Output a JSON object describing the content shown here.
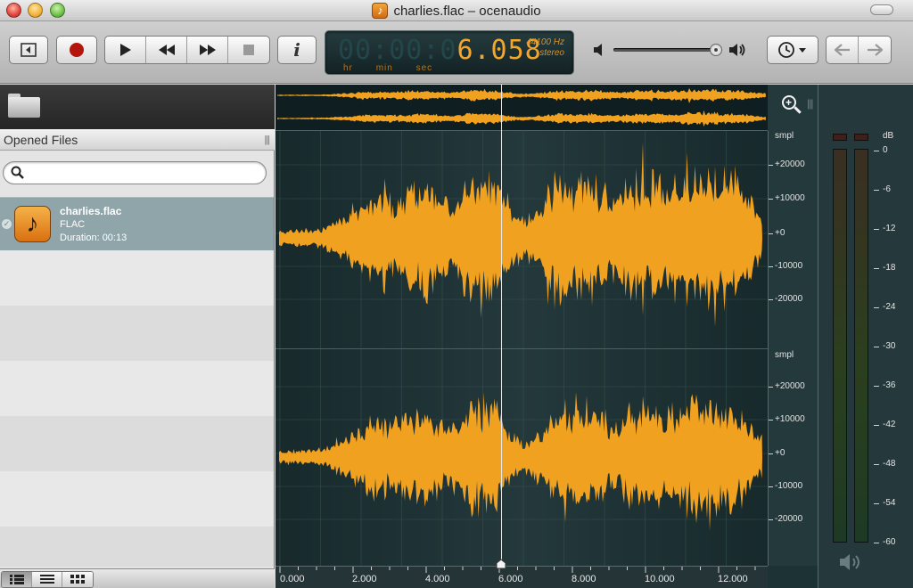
{
  "window": {
    "title": "charlies.flac – ocenaudio"
  },
  "toolbar": {
    "lcd": {
      "time_dim": "00:00:0",
      "time_lit": "6.058",
      "units": [
        "hr",
        "min",
        "sec"
      ],
      "rate": "44100 Hz",
      "channels": "stereo"
    },
    "volume": 0.95,
    "colors": {
      "accent": "#f4a62a",
      "lcd_bg": "#132224"
    }
  },
  "sidebar": {
    "header": "Opened Files",
    "search": {
      "value": "",
      "placeholder": ""
    },
    "files": [
      {
        "name": "charlies.flac",
        "type": "FLAC",
        "duration": "Duration: 00:13"
      }
    ]
  },
  "waveform": {
    "channel_scale": {
      "unit": "smpl",
      "ticks": [
        "+20000",
        "+10000",
        "+0",
        "-10000",
        "-20000"
      ]
    },
    "timeline": [
      "0.000",
      "2.000",
      "4.000",
      "6.000",
      "8.000",
      "10.000",
      "12.000"
    ],
    "cursor_time": 6.058,
    "color": "#f0a11f"
  },
  "meters": {
    "unit": "dB",
    "scale": [
      "0",
      "-6",
      "-12",
      "-18",
      "-24",
      "-30",
      "-36",
      "-42",
      "-48",
      "-54",
      "-60"
    ]
  }
}
